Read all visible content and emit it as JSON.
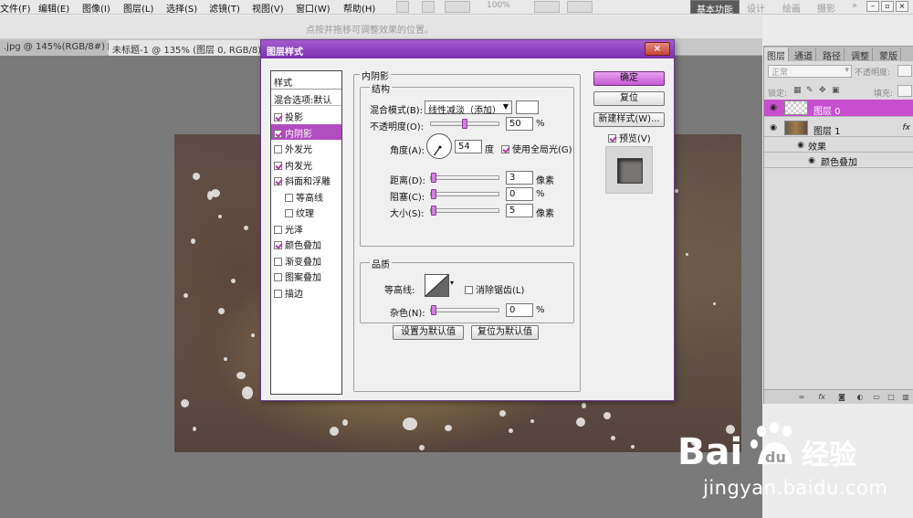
{
  "menubar": {
    "items": [
      "文件(F)",
      "编辑(E)",
      "图像(I)",
      "图层(L)",
      "选择(S)",
      "滤镜(T)",
      "视图(V)",
      "窗口(W)",
      "帮助(H)"
    ],
    "zoom": "100%",
    "workspaces": [
      "基本功能",
      "设计",
      "绘画",
      "摄影"
    ],
    "overflow": "»"
  },
  "options_bar": {
    "hint": "点按并拖移可调整效果的位置。"
  },
  "doc_tabs": [
    {
      "label": ".jpg @ 145%(RGB/8#)",
      "close": "×"
    },
    {
      "label": "未标题-1 @ 135% (图层 0, RGB/8)",
      "close": "×"
    }
  ],
  "dialog": {
    "title": "图层样式",
    "close": "×",
    "style_list": {
      "header": "样式",
      "blend_options": "混合选项:默认",
      "items": [
        {
          "label": "投影",
          "checked": true,
          "indent": false,
          "selected": false
        },
        {
          "label": "内阴影",
          "checked": true,
          "indent": false,
          "selected": true
        },
        {
          "label": "外发光",
          "checked": false,
          "indent": false,
          "selected": false
        },
        {
          "label": "内发光",
          "checked": true,
          "indent": false,
          "selected": false
        },
        {
          "label": "斜面和浮雕",
          "checked": true,
          "indent": false,
          "selected": false
        },
        {
          "label": "等高线",
          "checked": false,
          "indent": true,
          "selected": false
        },
        {
          "label": "纹理",
          "checked": false,
          "indent": true,
          "selected": false
        },
        {
          "label": "光泽",
          "checked": false,
          "indent": false,
          "selected": false
        },
        {
          "label": "颜色叠加",
          "checked": true,
          "indent": false,
          "selected": false
        },
        {
          "label": "渐变叠加",
          "checked": false,
          "indent": false,
          "selected": false
        },
        {
          "label": "图案叠加",
          "checked": false,
          "indent": false,
          "selected": false
        },
        {
          "label": "描边",
          "checked": false,
          "indent": false,
          "selected": false
        }
      ]
    },
    "inner_shadow": {
      "title": "内阴影",
      "structure": {
        "title": "结构",
        "blend_mode_label": "混合模式(B):",
        "blend_mode_value": "线性减淡（添加）",
        "swatch_color": "#ffffff",
        "opacity_label": "不透明度(O):",
        "opacity_value": "50",
        "opacity_unit": "%",
        "opacity_fraction": 0.5,
        "angle_label": "角度(A):",
        "angle_value": "54",
        "angle_unit": "度",
        "angle_degrees": 54,
        "global_light_label": "使用全局光(G)",
        "global_light_checked": true,
        "distance_label": "距离(D):",
        "distance_value": "3",
        "distance_unit": "像素",
        "distance_fraction": 0.01,
        "choke_label": "阻塞(C):",
        "choke_value": "0",
        "choke_unit": "%",
        "choke_fraction": 0,
        "size_label": "大小(S):",
        "size_value": "5",
        "size_unit": "像素",
        "size_fraction": 0.02
      },
      "quality": {
        "title": "品质",
        "contour_label": "等高线:",
        "anti_alias_label": "消除锯齿(L)",
        "anti_alias_checked": false,
        "noise_label": "杂色(N):",
        "noise_value": "0",
        "noise_unit": "%",
        "noise_fraction": 0
      },
      "make_default": "设置为默认值",
      "reset_default": "复位为默认值"
    },
    "buttons": {
      "ok": "确定",
      "reset": "复位",
      "new_style": "新建样式(W)...",
      "preview_label": "预览(V)",
      "preview_checked": true
    }
  },
  "layers_panel": {
    "tabs": [
      "图层",
      "通道",
      "路径",
      "调整",
      "蒙版"
    ],
    "blend_mode": "正常",
    "opacity_label": "不透明度:",
    "lock_label": "锁定:",
    "fill_label": "填充:",
    "layers": [
      {
        "name": "图层 0",
        "selected": true,
        "thumb": "checker"
      },
      {
        "name": "图层 1",
        "selected": false,
        "thumb": "photo"
      }
    ],
    "effects_label": "效果",
    "effect_item": "颜色叠加"
  },
  "watermark": {
    "url": "jingyan.baidu.com"
  },
  "colors": {
    "accent": "#b24cc1",
    "title_bar": "#8a3cc0",
    "selected_layer": "#c84ed0"
  }
}
